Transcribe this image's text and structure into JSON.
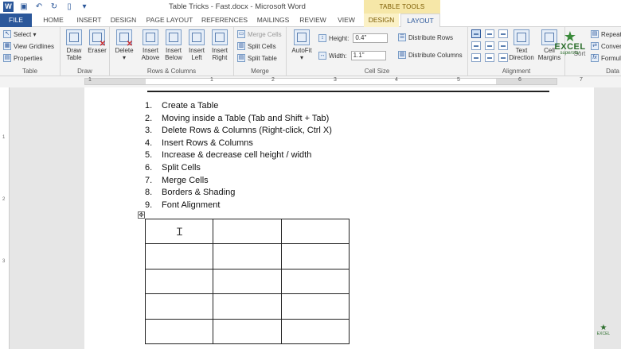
{
  "window": {
    "title": "Table Tricks - Fast.docx - Microsoft Word",
    "context_tab_group": "TABLE TOOLS"
  },
  "qat": {
    "icons": [
      "word-logo",
      "save-icon",
      "undo-icon",
      "redo-icon",
      "new-doc-icon",
      "customize-icon"
    ]
  },
  "tabs": {
    "file": "FILE",
    "home": "HOME",
    "insert": "INSERT",
    "design": "DESIGN",
    "page_layout": "PAGE LAYOUT",
    "references": "REFERENCES",
    "mailings": "MAILINGS",
    "review": "REVIEW",
    "view": "VIEW",
    "tt_design": "DESIGN",
    "tt_layout": "LAYOUT"
  },
  "ribbon": {
    "table": {
      "label": "Table",
      "select": "Select ▾",
      "view_gridlines": "View Gridlines",
      "properties": "Properties"
    },
    "draw": {
      "label": "Draw",
      "draw_table_1": "Draw",
      "draw_table_2": "Table",
      "eraser": "Eraser"
    },
    "rows_cols": {
      "label": "Rows & Columns",
      "delete": "Delete",
      "delete_arrow": "▾",
      "insert_above_1": "Insert",
      "insert_above_2": "Above",
      "insert_below_1": "Insert",
      "insert_below_2": "Below",
      "insert_left_1": "Insert",
      "insert_left_2": "Left",
      "insert_right_1": "Insert",
      "insert_right_2": "Right"
    },
    "merge": {
      "label": "Merge",
      "merge_cells": "Merge Cells",
      "split_cells": "Split Cells",
      "split_table": "Split Table"
    },
    "cell_size": {
      "label": "Cell Size",
      "autofit": "AutoFit",
      "autofit_arrow": "▾",
      "height_label": "Height:",
      "height_value": "0.4\"",
      "width_label": "Width:",
      "width_value": "1.1\"",
      "distribute_rows": "Distribute Rows",
      "distribute_columns": "Distribute Columns"
    },
    "alignment": {
      "label": "Alignment",
      "text_direction_1": "Text",
      "text_direction_2": "Direction",
      "cell_margins_1": "Cell",
      "cell_margins_2": "Margins",
      "sort_partial": "Sort"
    },
    "data": {
      "label": "Data",
      "repeat": "Repeat",
      "convert": "Conver",
      "formula": "Formul"
    }
  },
  "ruler": {
    "h_numbers": [
      "1",
      "1",
      "2",
      "3",
      "4",
      "5",
      "6",
      "7"
    ],
    "v_numbers": [
      "1",
      "2",
      "3"
    ]
  },
  "document": {
    "items": [
      {
        "num": "1.",
        "text": "Create a Table"
      },
      {
        "num": "2.",
        "text": "Moving inside a Table (Tab and Shift + Tab)"
      },
      {
        "num": "3.",
        "text": "Delete Rows & Columns (Right-click, Ctrl X)"
      },
      {
        "num": "4.",
        "text": "Insert Rows & Columns"
      },
      {
        "num": "5.",
        "text": "Increase & decrease cell height / width"
      },
      {
        "num": "6.",
        "text": "Split Cells"
      },
      {
        "num": "7.",
        "text": "Merge Cells"
      },
      {
        "num": "8.",
        "text": "Borders & Shading"
      },
      {
        "num": "9.",
        "text": "Font Alignment"
      }
    ],
    "table": {
      "rows": 5,
      "cols": 3
    }
  },
  "branding": {
    "logo_text": "EXCEL",
    "logo_sub": "superstar"
  },
  "colors": {
    "word_blue": "#2b579a",
    "context_yellow": "#f6e7a8",
    "logo_green": "#2c6e2c"
  }
}
